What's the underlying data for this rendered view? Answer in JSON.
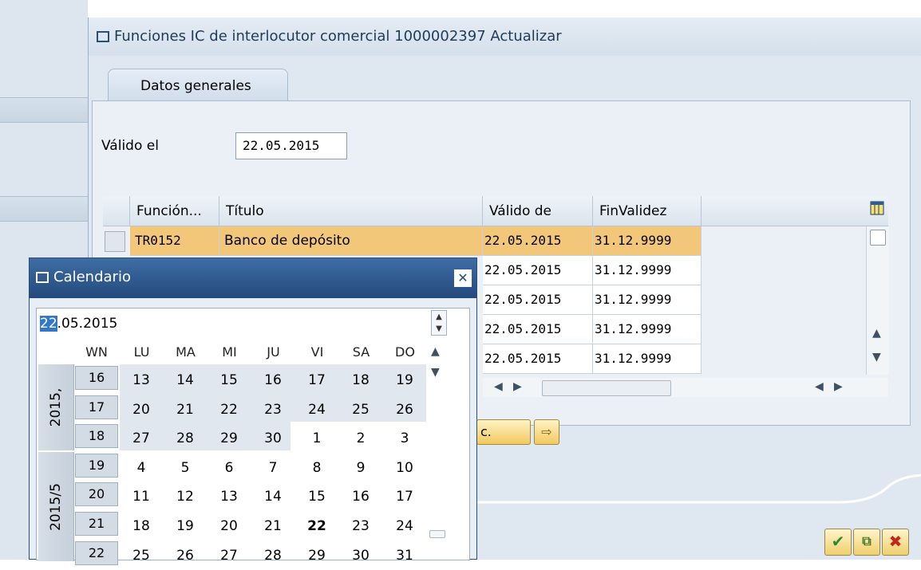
{
  "dialog": {
    "title": "Funciones IC de interlocutor comercial 1000002397 Actualizar",
    "tab": "Datos generales",
    "valid_label": "Válido el",
    "valid_value": "22.05.2015"
  },
  "table": {
    "headers": [
      "Función...",
      "Título",
      "Válido de",
      "FinValidez"
    ],
    "rows": [
      {
        "func": "TR0152",
        "title": "Banco de depósito",
        "from": "22.05.2015",
        "to": "31.12.9999"
      },
      {
        "func": "",
        "title": "",
        "from": "22.05.2015",
        "to": "31.12.9999"
      },
      {
        "func": "",
        "title": "",
        "from": "22.05.2015",
        "to": "31.12.9999"
      },
      {
        "func": "",
        "title": "",
        "from": "22.05.2015",
        "to": "31.12.9999"
      },
      {
        "func": "",
        "title": "",
        "from": "22.05.2015",
        "to": "31.12.9999"
      }
    ]
  },
  "buttons": {
    "partial_label": "c."
  },
  "calendar": {
    "title": "Calendario",
    "date_prefix": "22",
    "date_rest": ".05.2015",
    "headers": [
      "WN",
      "LU",
      "MA",
      "MI",
      "JU",
      "VI",
      "SA",
      "DO"
    ],
    "year_labels": [
      "2015,",
      "2015/5"
    ],
    "weeks": [
      {
        "wn": "16",
        "days": [
          "13",
          "14",
          "15",
          "16",
          "17",
          "18",
          "19"
        ]
      },
      {
        "wn": "17",
        "days": [
          "20",
          "21",
          "22",
          "23",
          "24",
          "25",
          "26"
        ]
      },
      {
        "wn": "18",
        "days": [
          "27",
          "28",
          "29",
          "30",
          "1",
          "2",
          "3"
        ]
      },
      {
        "wn": "19",
        "days": [
          "4",
          "5",
          "6",
          "7",
          "8",
          "9",
          "10"
        ]
      },
      {
        "wn": "20",
        "days": [
          "11",
          "12",
          "13",
          "14",
          "15",
          "16",
          "17"
        ]
      },
      {
        "wn": "21",
        "days": [
          "18",
          "19",
          "20",
          "21",
          "22",
          "23",
          "24"
        ]
      },
      {
        "wn": "22",
        "days": [
          "25",
          "26",
          "27",
          "28",
          "29",
          "30",
          "31"
        ]
      }
    ]
  },
  "colors": {
    "highlight_row": "#f3c77a",
    "title_bar": "#244a7d",
    "selection": "#3378c8"
  }
}
